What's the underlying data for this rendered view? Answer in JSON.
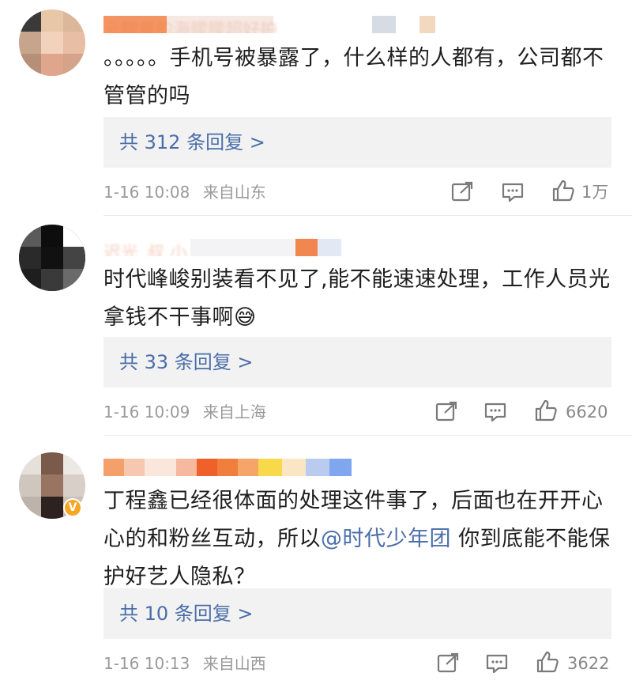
{
  "comments": [
    {
      "text": "。。。。。手机号被暴露了，什么样的人都有，公司都不管管的吗",
      "username": "云朦春的海朦朦超好拍",
      "replies_label": "共 312 条回复 >",
      "time": "1-16 10:08",
      "location": "来自山东",
      "likes": "1万"
    },
    {
      "text": "时代峰峻别装看不见了,能不能速速处理，工作人员光拿钱不干事啊😅",
      "username": "迟光_叔 小",
      "replies_label": "共 33 条回复 >",
      "time": "1-16 10:09",
      "location": "来自上海",
      "likes": "6620"
    },
    {
      "text_before": "丁程鑫已经很体面的处理这件事了，后面也在开开心心的和粉丝互动，所以",
      "mention": "@时代少年团",
      "text_after": " 你到底能不能保护好艺人隐私？",
      "replies_label": "共 10 条回复 >",
      "time": "1-16 10:13",
      "location": "来自山西",
      "likes": "3622",
      "verified_badge": "V"
    }
  ]
}
